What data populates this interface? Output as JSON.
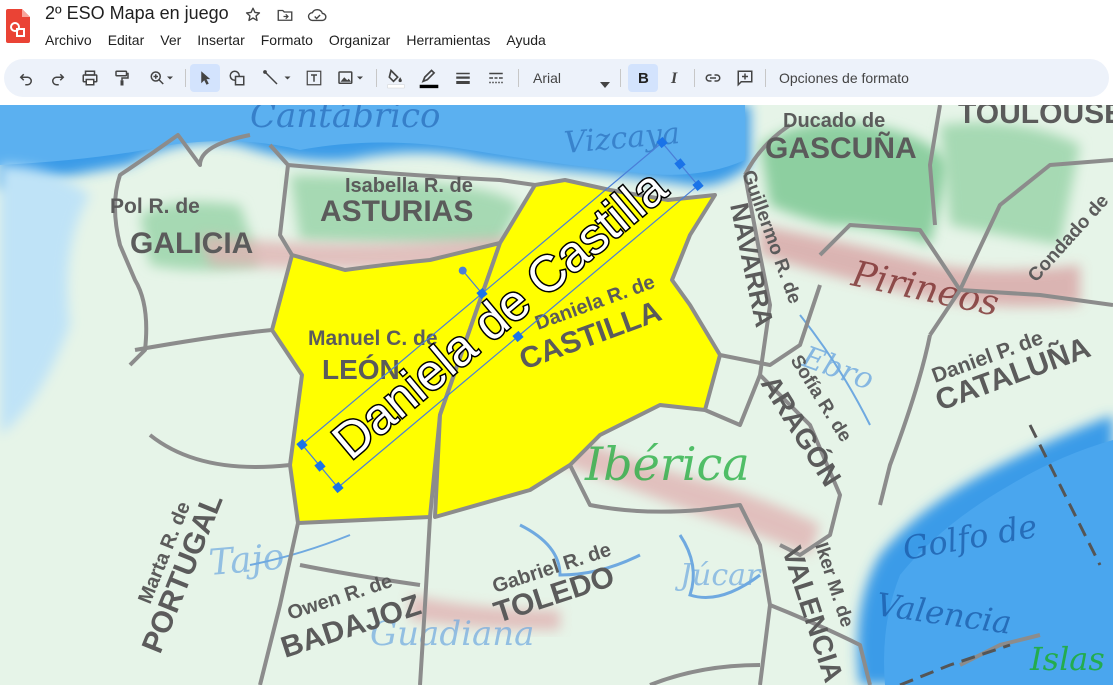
{
  "app": {
    "doc_title": "2º ESO Mapa en juego",
    "menu": [
      "Archivo",
      "Editar",
      "Ver",
      "Insertar",
      "Formato",
      "Organizar",
      "Herramientas",
      "Ayuda"
    ]
  },
  "toolbar": {
    "font_name": "Arial",
    "format_options_label": "Opciones de formato",
    "buttons": [
      "undo-icon",
      "redo-icon",
      "print-icon",
      "paint-format-icon",
      "zoom-icon",
      "select-icon",
      "shape-icon",
      "line-icon",
      "textbox-icon",
      "image-icon",
      "fill-color-icon",
      "border-color-icon",
      "border-weight-icon",
      "border-dash-icon",
      "bold-icon",
      "italic-icon",
      "link-icon",
      "comment-icon"
    ],
    "active": [
      "select",
      "bold"
    ]
  },
  "map": {
    "selected_textbox": "Daniela de Castilla",
    "regions": [
      {
        "owner": "Pol R. de",
        "name": "GALICIA"
      },
      {
        "owner": "Isabella R. de",
        "name": "ASTURIAS"
      },
      {
        "owner": "Manuel C. de",
        "name": "LEÓN"
      },
      {
        "owner": "Daniela R. de",
        "name": "CASTILLA"
      },
      {
        "owner": "Guillermo R. de",
        "name": "NAVARRA"
      },
      {
        "owner": "Ducado de",
        "name": "GASCUÑA"
      },
      {
        "owner": "",
        "name": "TOULOUSE"
      },
      {
        "owner": "Condado de",
        "name": ""
      },
      {
        "owner": "Daniel P. de",
        "name": "CATALUÑA"
      },
      {
        "owner": "Sofía R. de",
        "name": "ARAGÓN"
      },
      {
        "owner": "Marta R. de",
        "name": "PORTUGAL"
      },
      {
        "owner": "Owen R. de",
        "name": "BADAJOZ"
      },
      {
        "owner": "Gabriel R. de",
        "name": "TOLEDO"
      },
      {
        "owner": "Iker M. de",
        "name": "VALENCIA"
      }
    ],
    "background_labels": [
      "Cantábrico",
      "Vizcaya",
      "Pirineos",
      "Ebro",
      "Ibérica",
      "Tajo",
      "Guadiana",
      "Júcar",
      "Golfo de",
      "Valencia",
      "Islas"
    ],
    "colors": {
      "selected_region": "#ffff00",
      "border": "#8c8c8c",
      "land": "#e6f4e8",
      "sea": "#3b9be8",
      "accent": "#1a73e8"
    }
  }
}
